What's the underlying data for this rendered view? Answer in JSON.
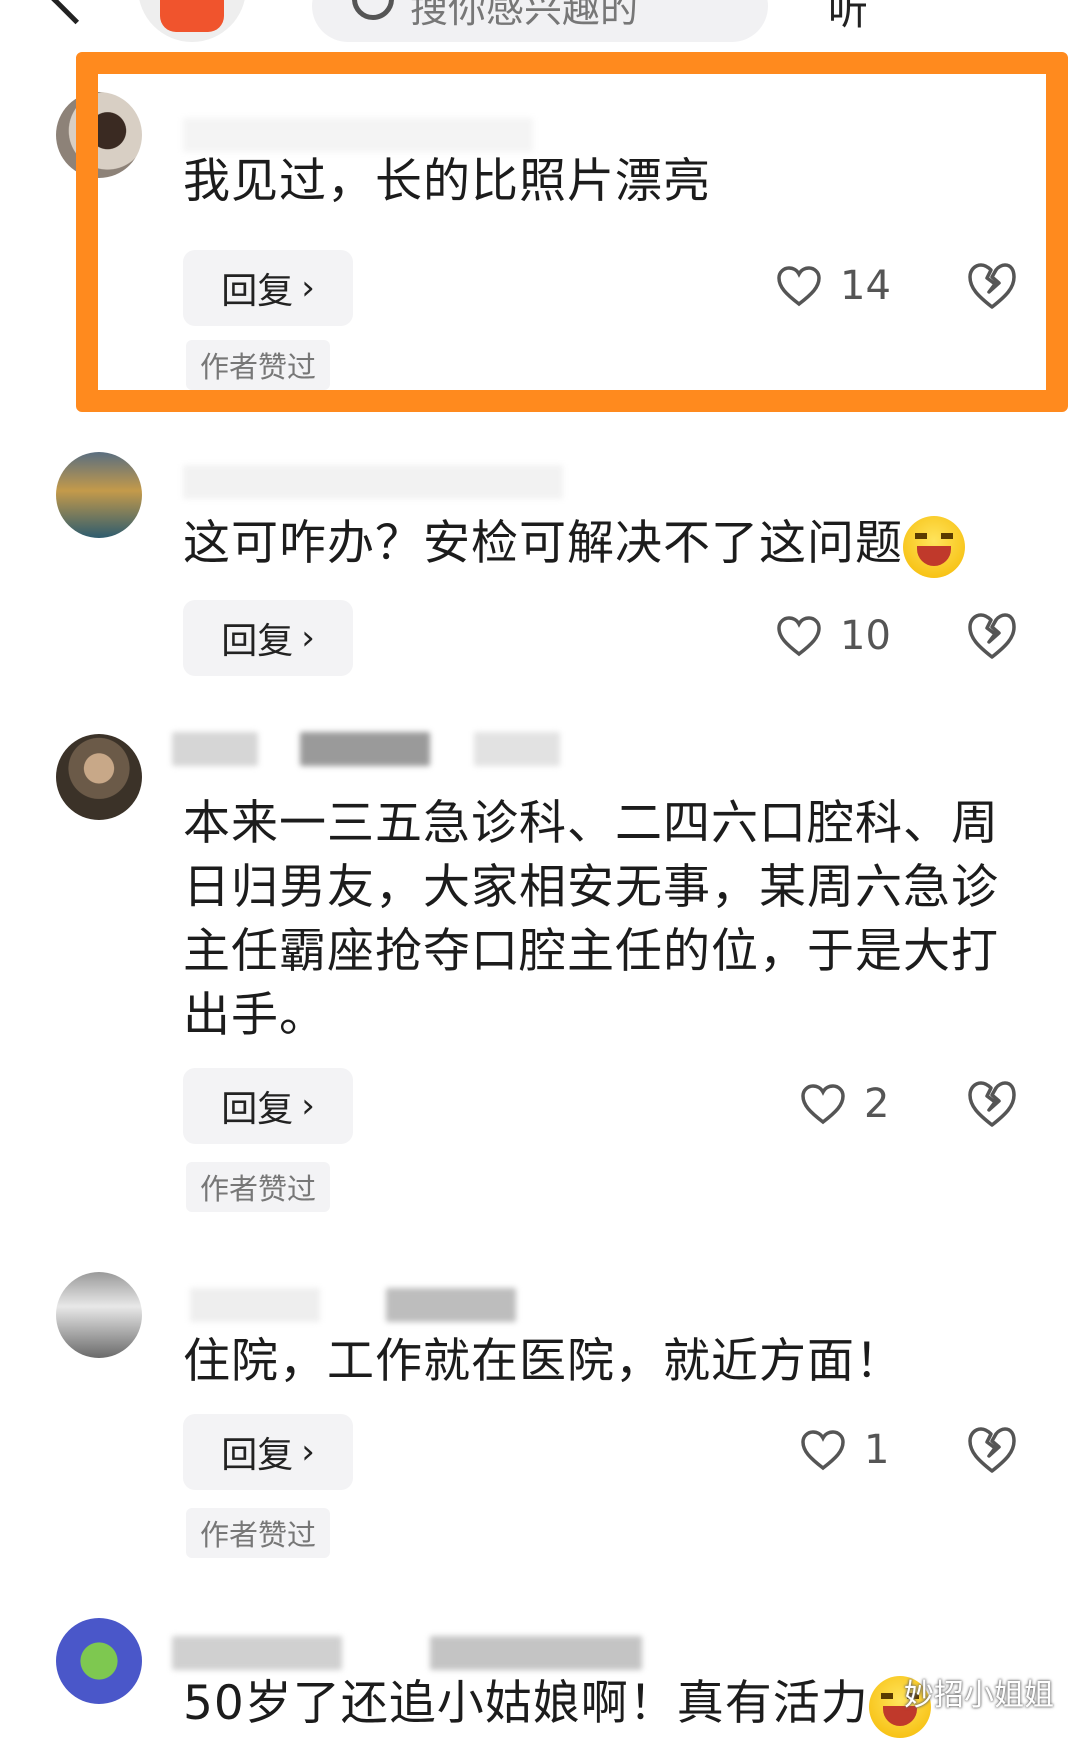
{
  "header": {
    "search_placeholder": "搜你感兴趣的",
    "right_label": "听"
  },
  "reply_label": "回复",
  "author_liked_label": "作者赞过",
  "comments": [
    {
      "text": "我见过，长的比照片漂亮",
      "likes": "14",
      "author_liked": true,
      "highlighted": true
    },
    {
      "text": "这可咋办？安检可解决不了这问题",
      "likes": "10",
      "author_liked": false,
      "emoji": "laughing-emoji"
    },
    {
      "text": "本来一三五急诊科、二四六口腔科、周日归男友，大家相安无事，某周六急诊主任霸座抢夺口腔主任的位，于是大打出手。",
      "likes": "2",
      "author_liked": true
    },
    {
      "text": "住院，工作就在医院，就近方面！",
      "likes": "1",
      "author_liked": true
    },
    {
      "text": "50岁了还追小姑娘啊！真有活力",
      "emoji": "grinning-emoji"
    }
  ],
  "watermark": "妙招小姐姐",
  "colors": {
    "highlight": "#ff8a1e",
    "button_bg": "#f3f3f5"
  }
}
